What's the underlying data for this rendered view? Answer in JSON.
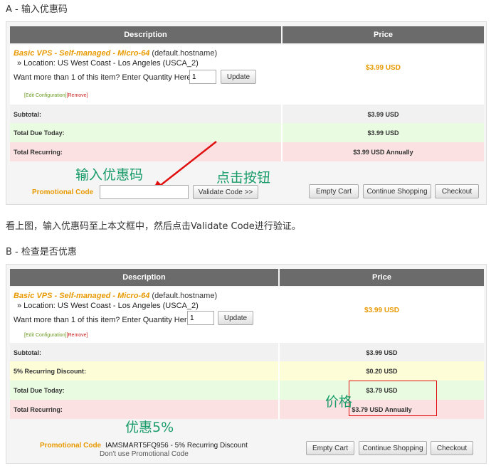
{
  "step_a": {
    "heading": "A - 输入优惠码",
    "table": {
      "header_description": "Description",
      "header_price": "Price",
      "product_name": "Basic VPS - Self-managed - Micro-64",
      "product_hostname": "(default.hostname)",
      "location": "» Location: US West Coast - Los Angeles (USCA_2)",
      "qty_prompt": "Want more than 1 of this item? Enter Quantity Here:",
      "qty_value": "1",
      "update_label": "Update",
      "product_price": "$3.99 USD",
      "edit_config": "[Edit Configuration]",
      "remove": "[Remove]",
      "subtotal_label": "Subtotal:",
      "subtotal_value": "$3.99 USD",
      "total_due_label": "Total Due Today:",
      "total_due_value": "$3.99 USD",
      "total_recurring_label": "Total Recurring:",
      "total_recurring_value": "$3.99 USD Annually"
    },
    "promo_label": "Promotional Code",
    "validate_label": "Validate Code >>",
    "empty_cart_label": "Empty Cart",
    "continue_label": "Continue Shopping",
    "checkout_label": "Checkout",
    "annotation_input": "输入优惠码",
    "annotation_click": "点击按钮"
  },
  "instruction": "看上图，输入优惠码至上本文框中，然后点击Validate Code进行验证。",
  "step_b": {
    "heading": "B - 检查是否优惠",
    "table": {
      "header_description": "Description",
      "header_price": "Price",
      "product_name": "Basic VPS - Self-managed - Micro-64",
      "product_hostname": "(default.hostname)",
      "location": "» Location: US West Coast - Los Angeles (USCA_2)",
      "qty_prompt": "Want more than 1 of this item? Enter Quantity Here:",
      "qty_value": "1",
      "update_label": "Update",
      "product_price": "$3.99 USD",
      "edit_config": "[Edit Configuration]",
      "remove": "[Remove]",
      "subtotal_label": "Subtotal:",
      "subtotal_value": "$3.99 USD",
      "discount_label": "5% Recurring Discount:",
      "discount_value": "$0.20 USD",
      "total_due_label": "Total Due Today:",
      "total_due_value": "$3.79 USD",
      "total_recurring_label": "Total Recurring:",
      "total_recurring_value": "$3.79 USD Annually"
    },
    "promo_label": "Promotional Code",
    "promo_applied": "IAMSMART5FQ956 - 5% Recurring Discount",
    "dont_use": "Don't use Promotional Code",
    "empty_cart_label": "Empty Cart",
    "continue_label": "Continue Shopping",
    "checkout_label": "Checkout",
    "annotation_price": "价格",
    "annotation_discount": "优惠5%"
  },
  "colors": {
    "accent_orange": "#e89a00",
    "header_grey": "#6b6b6b",
    "row_green": "#e9fbe0",
    "row_red": "#fbe1e1",
    "row_yellow": "#fdfdd8",
    "annotation_green": "#1a9c6a",
    "annotation_red": "#e01010"
  }
}
